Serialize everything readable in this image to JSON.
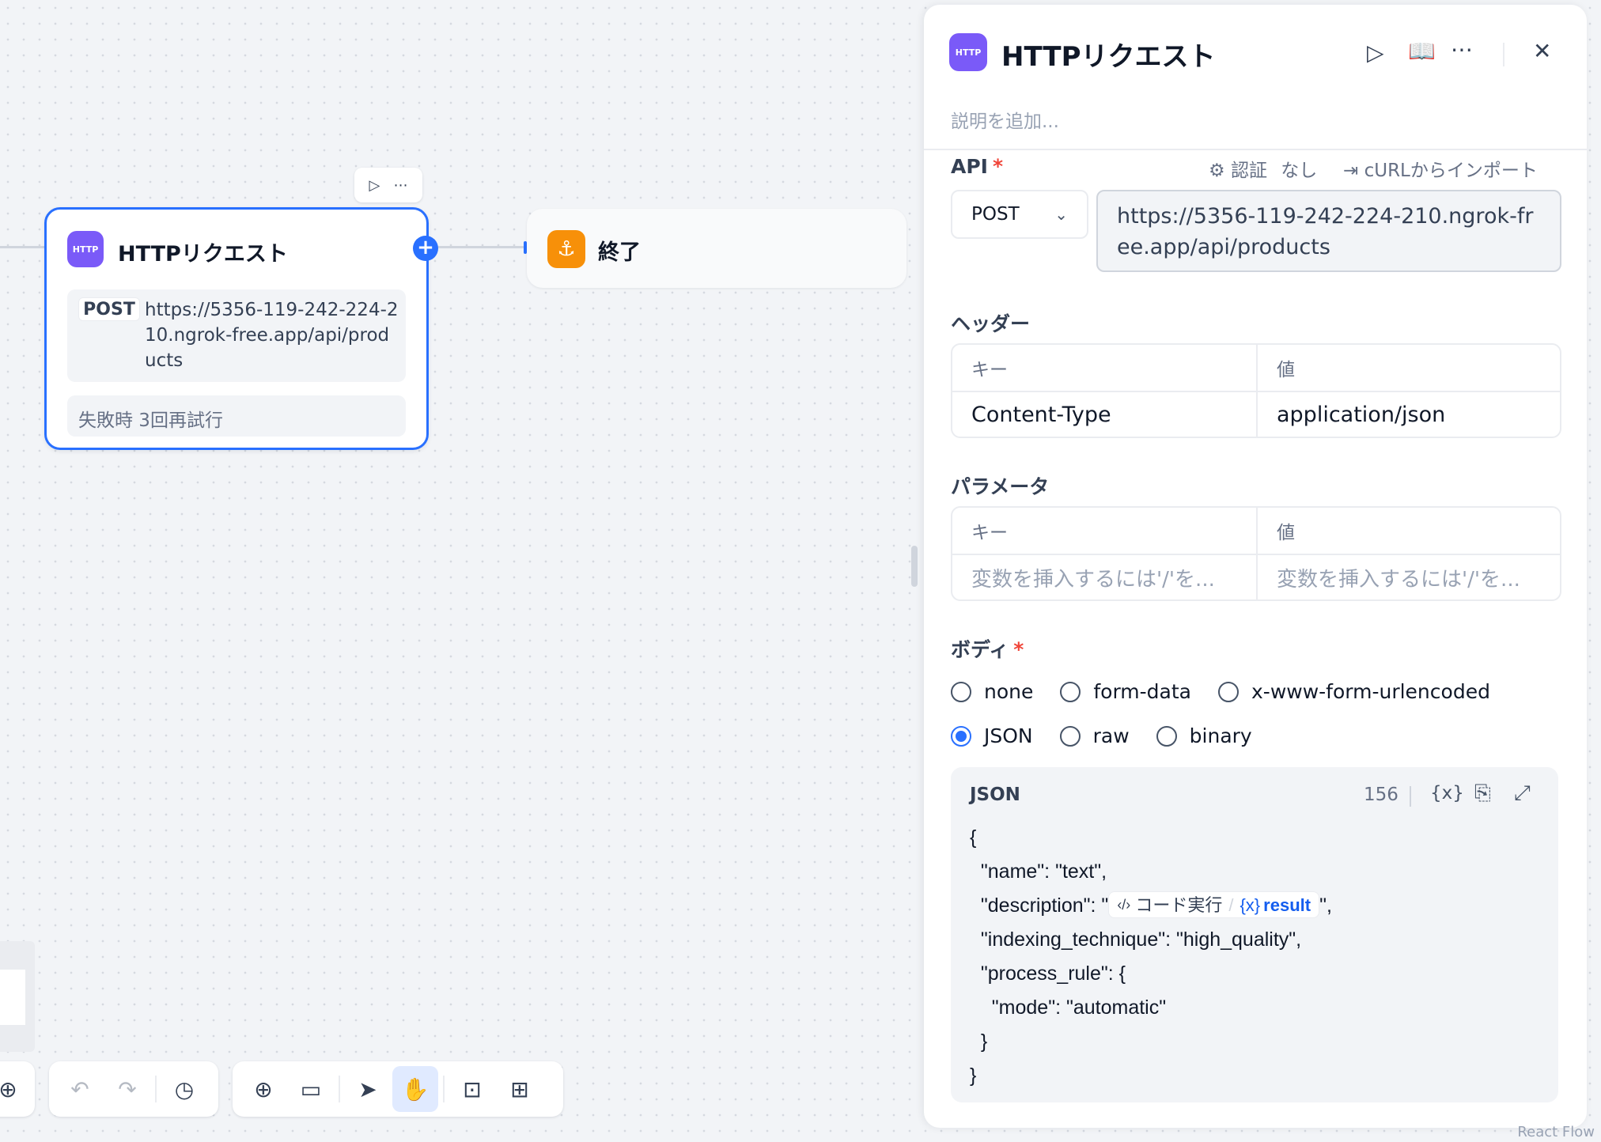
{
  "canvas": {
    "http_node": {
      "icon_text": "HTTP",
      "title": "HTTPリクエスト",
      "method": "POST",
      "url": "https://5356-119-242-224-210.ngrok-free.app/api/products",
      "retry_text": "失敗時 3回再試行",
      "toolbar": {
        "run_icon": "play-icon",
        "more_icon": "more-icon"
      },
      "add_handle": "+"
    },
    "end_node": {
      "title": "終了",
      "icon": "end-icon"
    }
  },
  "panel": {
    "icon_text": "HTTP",
    "title": "HTTPリクエスト",
    "description_placeholder": "説明を追加...",
    "api": {
      "label": "API",
      "required_mark": "*",
      "auth_label": "認証",
      "auth_value": "なし",
      "import_label": "cURLからインポート",
      "method": "POST",
      "url": "https://5356-119-242-224-210.ngrok-free.app/api/products"
    },
    "headers": {
      "label": "ヘッダー",
      "col_key": "キー",
      "col_value": "値",
      "rows": [
        {
          "key": "Content-Type",
          "value": "application/json"
        }
      ]
    },
    "params": {
      "label": "パラメータ",
      "col_key": "キー",
      "col_value": "値",
      "key_placeholder": "変数を挿入するには'/'を...",
      "value_placeholder": "変数を挿入するには'/'を..."
    },
    "body": {
      "label": "ボディ",
      "required_mark": "*",
      "options_row1": [
        "none",
        "form-data",
        "x-www-form-urlencoded"
      ],
      "options_row2": [
        "JSON",
        "raw",
        "binary"
      ],
      "selected": "JSON",
      "json": {
        "header_label": "JSON",
        "char_count": "156",
        "lines": {
          "open": "{",
          "name": "  \"name\": \"text\",",
          "description_prefix": "  \"description\": \"",
          "description_suffix": "\",",
          "indexing": "  \"indexing_technique\": \"high_quality\",",
          "process_rule": "  \"process_rule\": {",
          "mode": "    \"mode\": \"automatic\"",
          "inner_close": "  }",
          "close": "}"
        },
        "variable_chip": {
          "source": "コード実行",
          "variable": "result"
        }
      }
    }
  },
  "watermark": "React Flow"
}
